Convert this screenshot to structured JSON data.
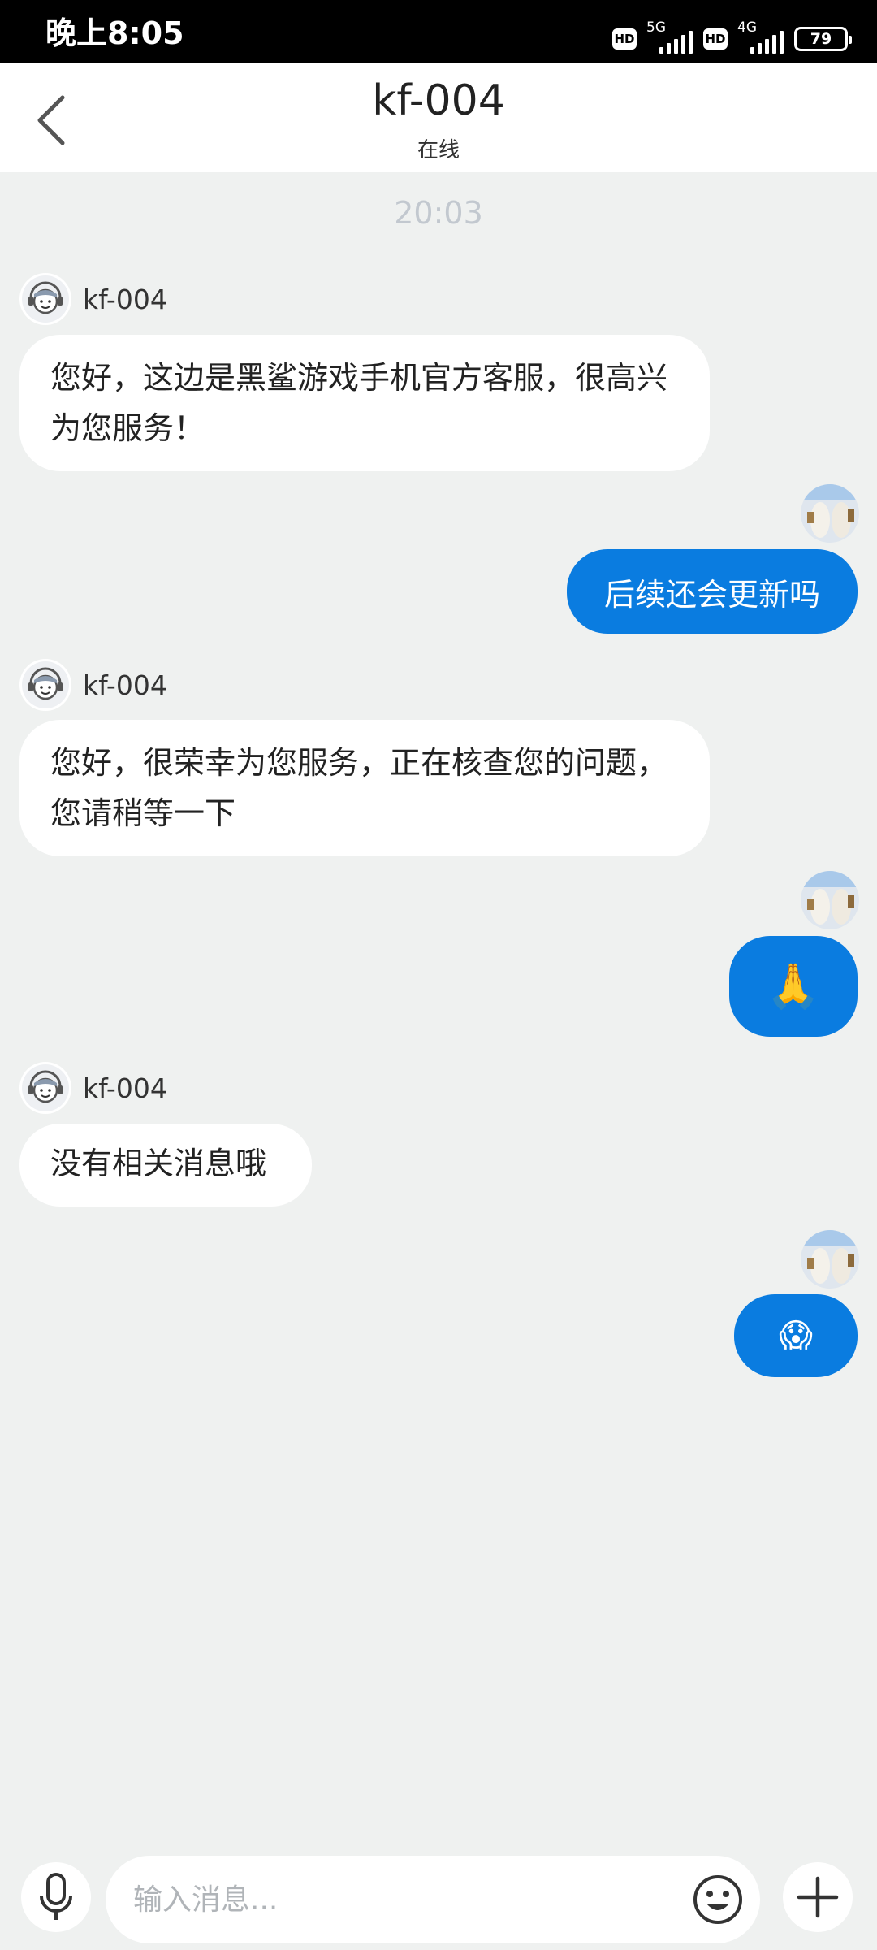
{
  "status_bar": {
    "time": "晚上8:05",
    "hd_1": "HD",
    "network_1": "5G",
    "hd_2": "HD",
    "network_2": "4G",
    "battery": "79"
  },
  "header": {
    "title": "kf-004",
    "subtitle": "在线"
  },
  "chat": {
    "timestamp": "20:03",
    "messages": [
      {
        "from": "agent",
        "name": "kf-004",
        "text": "您好，这边是黑鲨游戏手机官方客服，很高兴为您服务！"
      },
      {
        "from": "user",
        "text": "后续还会更新吗"
      },
      {
        "from": "agent",
        "name": "kf-004",
        "text": "您好，很荣幸为您服务，正在核查您的问题，您请稍等一下"
      },
      {
        "from": "user",
        "text": "🙏"
      },
      {
        "from": "agent",
        "name": "kf-004",
        "text": "没有相关消息哦"
      },
      {
        "from": "user",
        "text": "😱"
      }
    ]
  },
  "input_bar": {
    "placeholder": "输入消息..."
  },
  "colors": {
    "accent": "#0a7ce0",
    "background": "#eff1f0"
  }
}
